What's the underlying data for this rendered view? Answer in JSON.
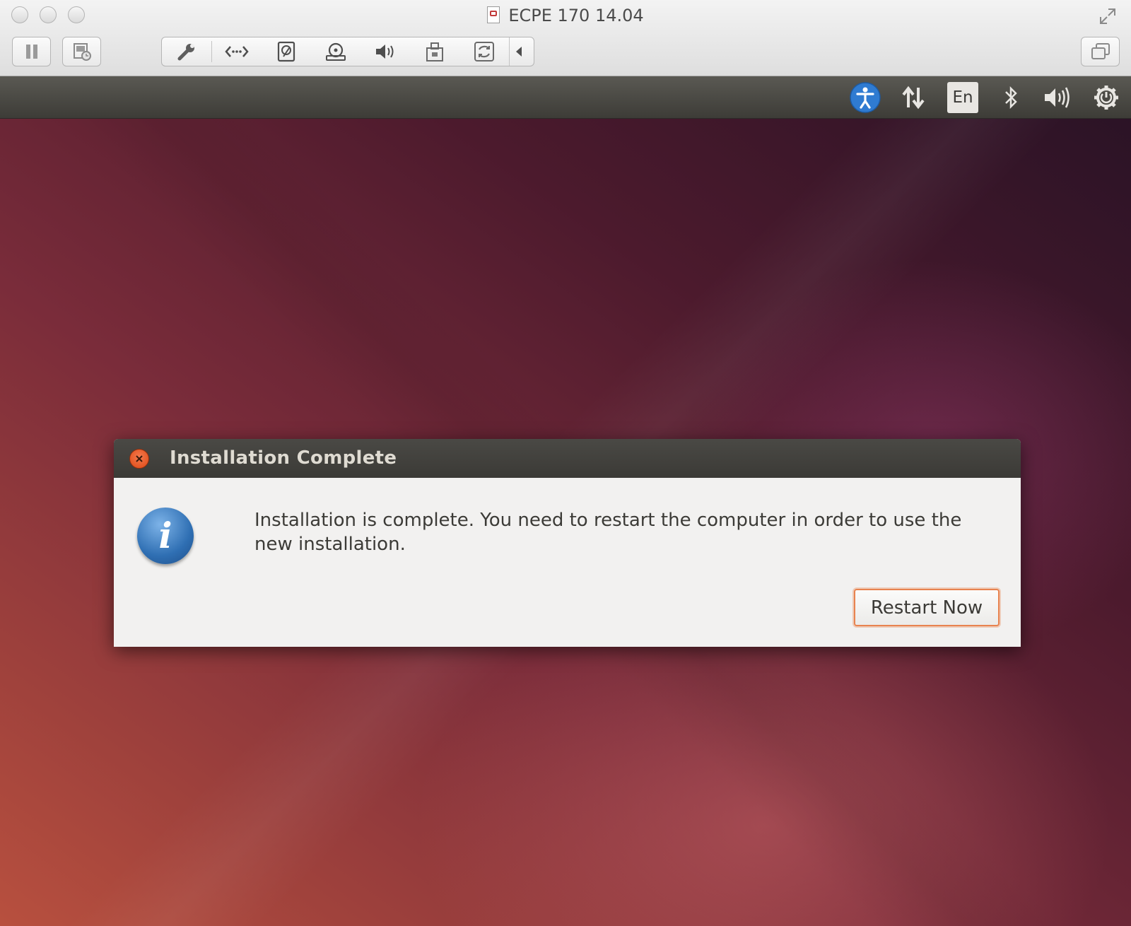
{
  "host_window": {
    "title": "ECPE 170 14.04",
    "traffic_lights": [
      "close",
      "minimize",
      "zoom"
    ],
    "toolbar": [
      {
        "name": "pause-icon"
      },
      {
        "name": "snapshot-icon"
      },
      {
        "name": "settings-wrench-icon"
      },
      {
        "name": "network-icon"
      },
      {
        "name": "hard-disk-icon"
      },
      {
        "name": "optical-disc-icon"
      },
      {
        "name": "sound-icon"
      },
      {
        "name": "usb-icon"
      },
      {
        "name": "shared-folder-sync-icon"
      },
      {
        "name": "collapse-arrow-icon"
      },
      {
        "name": "window-mode-icon"
      }
    ]
  },
  "ubuntu_panel": {
    "indicators": [
      {
        "name": "accessibility-icon"
      },
      {
        "name": "network-updown-icon"
      },
      {
        "name": "keyboard-layout",
        "label": "En"
      },
      {
        "name": "bluetooth-icon"
      },
      {
        "name": "volume-icon"
      },
      {
        "name": "power-gear-icon"
      }
    ],
    "keyboard_label": "En"
  },
  "dialog": {
    "title": "Installation Complete",
    "message": "Installation is complete. You need to restart the computer in order to use the new installation.",
    "icon": "info-icon",
    "restart_button": "Restart Now"
  },
  "colors": {
    "ubuntu_orange": "#dd4814",
    "panel_dark": "#3c3b37",
    "dialog_bg": "#f2f1f0",
    "info_blue": "#2f6fb3"
  }
}
